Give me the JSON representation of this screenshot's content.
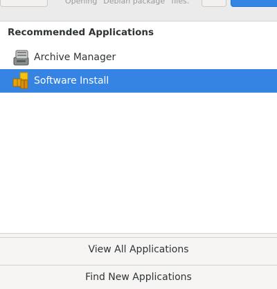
{
  "header": {
    "subtitle": "Opening “Debian package” files."
  },
  "list": {
    "section_title": "Recommended Applications",
    "items": [
      {
        "label": "Archive Manager",
        "icon": "archive-manager-icon",
        "selected": false
      },
      {
        "label": "Software Install",
        "icon": "software-install-icon",
        "selected": true
      }
    ]
  },
  "footer": {
    "view_all_label": "View All Applications",
    "find_new_label": "Find New Applications"
  },
  "colors": {
    "selection": "#3584e4",
    "window_bg": "#f6f5f4",
    "list_bg": "#ffffff"
  }
}
